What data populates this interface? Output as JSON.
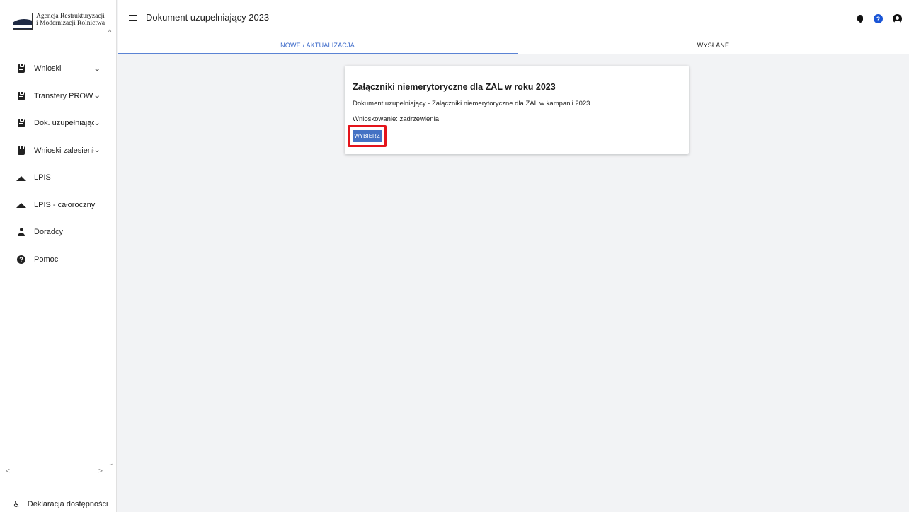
{
  "logo": {
    "line1": "Agencja Restrukturyzacji",
    "line2": "i Modernizacji Rolnictwa"
  },
  "sidebar": {
    "items": [
      {
        "label": "Wnioski",
        "icon": "clipboard-icon",
        "has_chevron": true
      },
      {
        "label": "Transfery PROW",
        "icon": "clipboard-icon",
        "has_chevron": true
      },
      {
        "label": "Dok. uzupełniające",
        "icon": "clipboard-icon",
        "has_chevron": true
      },
      {
        "label": "Wnioski zalesieniowe",
        "icon": "clipboard-icon",
        "has_chevron": true
      },
      {
        "label": "LPIS",
        "icon": "terrain-icon",
        "has_chevron": false
      },
      {
        "label": "LPIS - całoroczny",
        "icon": "terrain-icon",
        "has_chevron": false
      },
      {
        "label": "Doradcy",
        "icon": "person-icon",
        "has_chevron": false
      },
      {
        "label": "Pomoc",
        "icon": "help-icon",
        "has_chevron": false
      }
    ],
    "chevron": "⌄",
    "scroll_up": "^",
    "scroll_down": "⌄",
    "scroll_left": "<",
    "scroll_right": ">",
    "accessibility_label": "Deklaracja dostępności",
    "accessibility_icon": "♿"
  },
  "header": {
    "title": "Dokument uzupełniający 2023",
    "help_glyph": "?"
  },
  "tabs": [
    {
      "label": "NOWE / AKTUALIZACJA",
      "active": true
    },
    {
      "label": "WYSŁANE",
      "active": false
    }
  ],
  "card": {
    "title": "Załączniki niemerytoryczne dla ZAL w roku 2023",
    "description": "Dokument uzupełniający - Załączniki niemerytoryczne dla ZAL w kampanii 2023.",
    "subtitle": "Wnioskowanie: zadrzewienia",
    "button_label": "WYBIERZ"
  },
  "colors": {
    "accent": "#4472c4",
    "tab_active": "#3b69c9",
    "highlight": "#e4141b",
    "help_icon": "#1a55d6",
    "background": "#f2f3f5"
  }
}
